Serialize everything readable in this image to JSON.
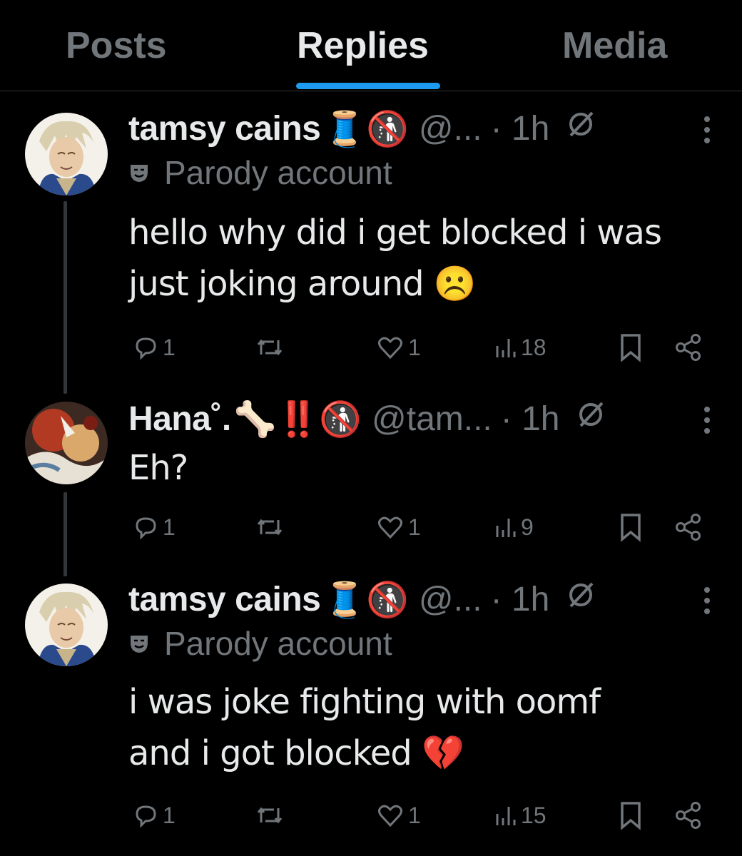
{
  "tabs": [
    {
      "label": "Posts",
      "active": false
    },
    {
      "label": "Replies",
      "active": true
    },
    {
      "label": "Media",
      "active": false
    }
  ],
  "posts": [
    {
      "name": "tamsy cains",
      "emojis": "🧵🚯",
      "handle": "@...",
      "time": "· 1h",
      "parody_label": "Parody account",
      "text_lines": [
        "hello why did i get blocked i was",
        "just joking around ☹️"
      ],
      "replies": "1",
      "reposts": "",
      "likes": "1",
      "views": "18"
    },
    {
      "name": "Hana˚.",
      "emojis": "🦴‼️🚯",
      "handle": "@tam...",
      "time": "· 1h",
      "parody_label": "",
      "text_lines": [
        "Eh?"
      ],
      "replies": "1",
      "reposts": "",
      "likes": "1",
      "views": "9"
    },
    {
      "name": "tamsy cains",
      "emojis": "🧵🚯",
      "handle": "@...",
      "time": "· 1h",
      "parody_label": "Parody account",
      "text_lines": [
        "i was joke fighting with oomf",
        "and i got blocked 💔"
      ],
      "replies": "1",
      "reposts": "",
      "likes": "1",
      "views": "15"
    }
  ],
  "colors": {
    "background": "#000000",
    "text": "#e7e9ea",
    "muted": "#71767b",
    "accent": "#1d9bf0"
  },
  "icons": [
    "reply-icon",
    "repost-icon",
    "like-icon",
    "views-icon",
    "bookmark-icon",
    "share-icon",
    "more-icon",
    "parody-mask-icon",
    "no-parody-icon"
  ]
}
